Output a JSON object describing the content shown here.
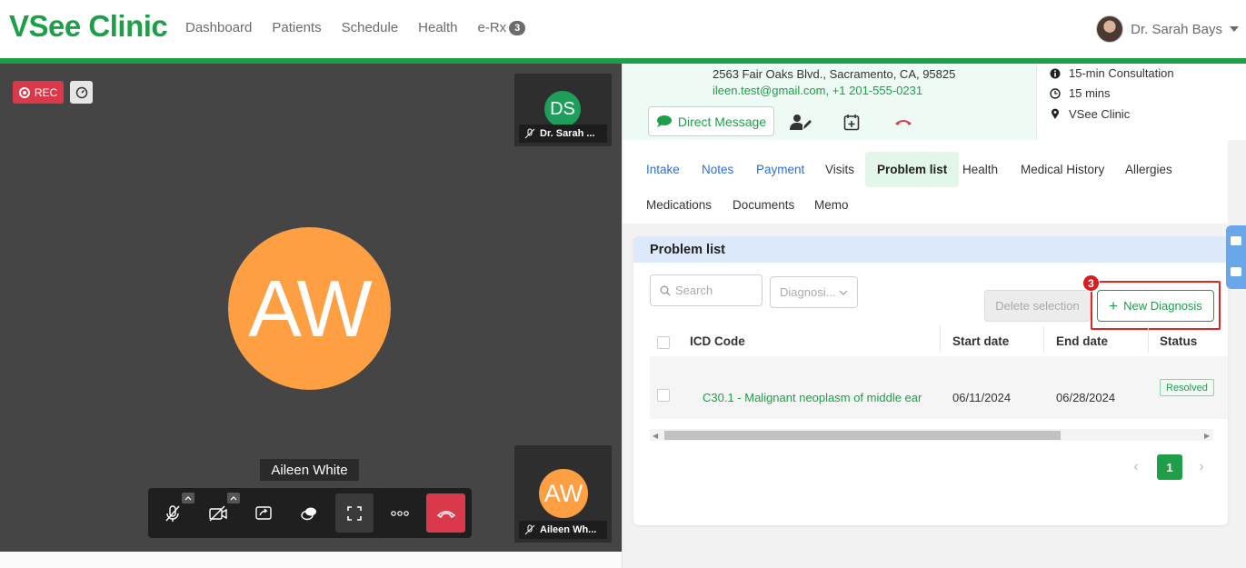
{
  "app": {
    "logo": "VSee Clinic",
    "nav": [
      "Dashboard",
      "Patients",
      "Schedule",
      "Health",
      "e-Rx"
    ],
    "erx_badge": "3",
    "user_name": "Dr. Sarah Bays"
  },
  "video": {
    "rec_label": "REC",
    "main_initials": "AW",
    "main_name": "Aileen White",
    "tiles": [
      {
        "initials": "DS",
        "label": "Dr. Sarah ...",
        "color": "#1e9e5a"
      },
      {
        "initials": "AW",
        "label": "Aileen Wh...",
        "color": "#ff9f43"
      }
    ]
  },
  "patient": {
    "address": "2563 Fair Oaks Blvd., Sacramento, CA, 95825",
    "email": "ileen.test@gmail.com",
    "phone": "+1 201-555-0231",
    "dm_label": "Direct Message"
  },
  "appointment": {
    "type": "15-min Consultation",
    "duration": "15 mins",
    "location": "VSee Clinic"
  },
  "tabs": [
    {
      "label": "Intake"
    },
    {
      "label": "Notes"
    },
    {
      "label": "Payment"
    },
    {
      "label": "Visits"
    },
    {
      "label": "Problem list"
    },
    {
      "label": "Health"
    },
    {
      "label": "Medical History"
    },
    {
      "label": "Allergies"
    },
    {
      "label": "Medications"
    },
    {
      "label": "Documents"
    },
    {
      "label": "Memo"
    }
  ],
  "problem_list": {
    "title": "Problem list",
    "search_placeholder": "Search",
    "diagnosis_filter": "Diagnosi...",
    "delete_label": "Delete selection",
    "new_label": "New Diagnosis",
    "step_badge": "3",
    "columns": [
      "ICD Code",
      "Start date",
      "End date",
      "Status"
    ],
    "rows": [
      {
        "icd": "C30.1 - Malignant neoplasm of middle ear",
        "start": "06/11/2024",
        "end": "06/28/2024",
        "status": "Resolved"
      }
    ],
    "current_page": "1"
  },
  "colors": {
    "brand": "#1e9e49",
    "danger": "#d9394b",
    "link": "#2f6dd0"
  }
}
